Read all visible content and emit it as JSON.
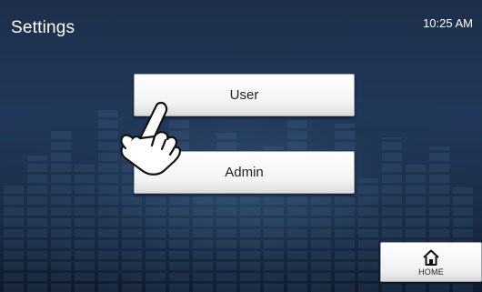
{
  "header": {
    "title": "Settings",
    "time": "10:25 AM"
  },
  "menu": {
    "buttons": [
      {
        "label": "User"
      },
      {
        "label": "Admin"
      }
    ]
  },
  "footer": {
    "home_label": "HOME",
    "home_icon": "home-icon"
  },
  "pointer": {
    "icon": "hand-pointer-icon"
  },
  "colors": {
    "background": "#1d2f4a",
    "button_face": "#ffffff",
    "text_light": "#ffffff",
    "text_dark": "#222222"
  }
}
